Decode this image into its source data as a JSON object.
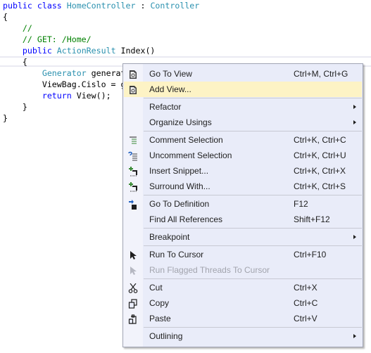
{
  "editor": {
    "lines": [
      {
        "tokens": [
          {
            "t": "public",
            "c": "kw"
          },
          {
            "t": " "
          },
          {
            "t": "class",
            "c": "kw"
          },
          {
            "t": " "
          },
          {
            "t": "HomeController",
            "c": "ty"
          },
          {
            "t": " : "
          },
          {
            "t": "Controller",
            "c": "ty"
          }
        ]
      },
      {
        "tokens": [
          {
            "t": "{"
          }
        ]
      },
      {
        "tokens": [
          {
            "t": "    "
          },
          {
            "t": "//",
            "c": "cm"
          }
        ]
      },
      {
        "tokens": [
          {
            "t": "    "
          },
          {
            "t": "// GET: /Home/",
            "c": "cm"
          }
        ]
      },
      {
        "tokens": [
          {
            "t": "    "
          },
          {
            "t": "public",
            "c": "kw"
          },
          {
            "t": " "
          },
          {
            "t": "ActionResult",
            "c": "ty"
          },
          {
            "t": " Index()"
          }
        ]
      },
      {
        "tokens": [
          {
            "t": "    {"
          }
        ]
      },
      {
        "tokens": [
          {
            "t": "        "
          },
          {
            "t": "Generator",
            "c": "ty"
          },
          {
            "t": " generat"
          }
        ]
      },
      {
        "tokens": [
          {
            "t": "        ViewBag.Cislo = g"
          }
        ]
      },
      {
        "tokens": [
          {
            "t": "        "
          },
          {
            "t": "return",
            "c": "kw"
          },
          {
            "t": " View();"
          }
        ]
      },
      {
        "tokens": [
          {
            "t": "    }"
          }
        ]
      },
      {
        "tokens": [
          {
            "t": "}"
          }
        ]
      }
    ]
  },
  "context_menu": {
    "items": [
      {
        "label": "Go To View",
        "shortcut": "Ctrl+M, Ctrl+G",
        "icon": "view-page-icon"
      },
      {
        "label": "Add View...",
        "shortcut": "",
        "icon": "view-page-icon",
        "highlighted": true
      },
      {
        "separator": true
      },
      {
        "label": "Refactor",
        "submenu": true
      },
      {
        "label": "Organize Usings",
        "submenu": true
      },
      {
        "separator": true
      },
      {
        "label": "Comment Selection",
        "shortcut": "Ctrl+K, Ctrl+C",
        "icon": "comment-icon"
      },
      {
        "label": "Uncomment Selection",
        "shortcut": "Ctrl+K, Ctrl+U",
        "icon": "uncomment-icon"
      },
      {
        "label": "Insert Snippet...",
        "shortcut": "Ctrl+K, Ctrl+X",
        "icon": "snippet-icon"
      },
      {
        "label": "Surround With...",
        "shortcut": "Ctrl+K, Ctrl+S",
        "icon": "snippet-icon"
      },
      {
        "separator": true
      },
      {
        "label": "Go To Definition",
        "shortcut": "F12",
        "icon": "go-to-definition-icon"
      },
      {
        "label": "Find All References",
        "shortcut": "Shift+F12"
      },
      {
        "separator": true
      },
      {
        "label": "Breakpoint",
        "submenu": true
      },
      {
        "separator": true
      },
      {
        "label": "Run To Cursor",
        "shortcut": "Ctrl+F10",
        "icon": "cursor-arrow-icon"
      },
      {
        "label": "Run Flagged Threads To Cursor",
        "disabled": true,
        "icon": "cursor-arrow-icon"
      },
      {
        "separator": true
      },
      {
        "label": "Cut",
        "shortcut": "Ctrl+X",
        "icon": "scissors-icon"
      },
      {
        "label": "Copy",
        "shortcut": "Ctrl+C",
        "icon": "copy-icon"
      },
      {
        "label": "Paste",
        "shortcut": "Ctrl+V",
        "icon": "paste-icon"
      },
      {
        "separator": true
      },
      {
        "label": "Outlining",
        "submenu": true
      }
    ]
  },
  "colors": {
    "keyword": "#0000ff",
    "type": "#2b91af",
    "comment": "#008000",
    "menu_bg": "#e9ecf9",
    "menu_highlight": "#fdf3c5",
    "disabled_text": "#a2a4ad"
  }
}
